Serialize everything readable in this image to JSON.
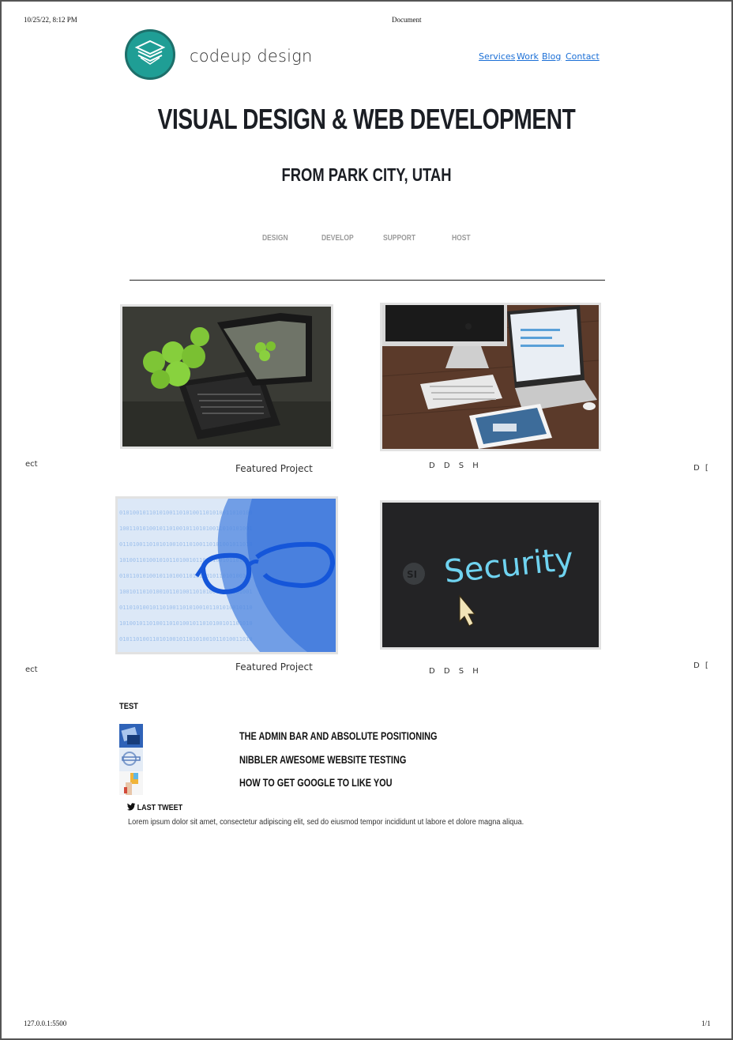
{
  "print_header": {
    "datetime": "10/25/22, 8:12 PM",
    "title": "Document"
  },
  "print_footer": {
    "url": "127.0.0.1:5500",
    "page": "1/1"
  },
  "brand": {
    "name": "codeup design",
    "logo_icon": "layers-icon",
    "logo_color": "#1f9e95"
  },
  "nav": [
    "Services",
    "Work",
    "Blog",
    "Contact"
  ],
  "hero": {
    "title": "VISUAL DESIGN & WEB DEVELOPMENT",
    "subtitle": "FROM PARK CITY, UTAH"
  },
  "services": [
    "DESIGN",
    "DEVELOP",
    "SUPPORT",
    "HOST"
  ],
  "projects": {
    "row1": {
      "left_fragment": "ect",
      "caption": "Featured Project",
      "letters": "D D S H",
      "right_fragment": "D ["
    },
    "row2": {
      "left_fragment": "ect",
      "caption": "Featured Project",
      "letters": "D D S H",
      "right_fragment": "D ["
    }
  },
  "test": {
    "heading": "TEST",
    "posts": [
      "THE ADMIN BAR AND ABSOLUTE POSITIONING",
      "NIBBLER AWESOME WEBSITE TESTING",
      "HOW TO GET GOOGLE TO LIKE YOU"
    ]
  },
  "tweet": {
    "heading": "LAST TWEET",
    "icon": "twitter-bird-icon",
    "body": "Lorem ipsum dolor sit amet, consectetur adipiscing elit, sed do eiusmod tempor incididunt ut labore et dolore magna aliqua."
  },
  "colors": {
    "accent": "#1f9e95",
    "link": "#1b6fd6",
    "service_gray": "#9a9a9a"
  }
}
